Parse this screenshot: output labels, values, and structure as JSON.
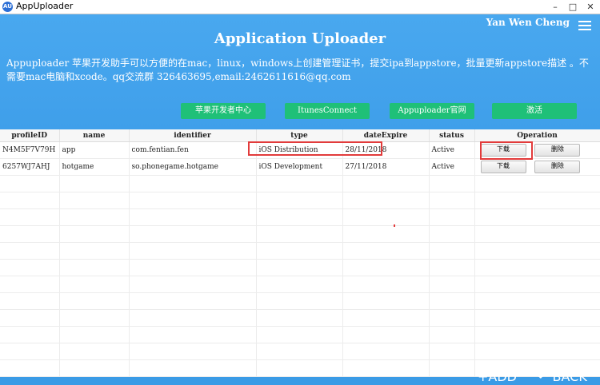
{
  "window": {
    "title": "AppUploader",
    "icon": "app-icon"
  },
  "header": {
    "user": "Yan Wen Cheng",
    "title": "Application Uploader",
    "description": "Appuploader 苹果开发助手可以方便的在mac，linux，windows上创建管理证书，提交ipa到appstore，批量更新appstore描述 。不需要mac电脑和xcode。qq交流群 326463695,email:2462611616@qq.com"
  },
  "nav": [
    {
      "label": "苹果开发者中心"
    },
    {
      "label": "ItunesConnect"
    },
    {
      "label": "Appuploader官网"
    },
    {
      "label": "激活"
    }
  ],
  "table": {
    "columns": [
      "profileID",
      "name",
      "identifier",
      "type",
      "dateExpire",
      "status",
      "Operation"
    ],
    "rows": [
      {
        "profileID": "N4M5F7V79H",
        "name": "app",
        "identifier": "com.fentian.fen",
        "type": "iOS Distribution",
        "dateExpire": "28/11/2018",
        "status": "Active",
        "download": "下载",
        "delete": "删除"
      },
      {
        "profileID": "6257WJ7AHJ",
        "name": "hotgame",
        "identifier": "so.phonegame.hotgame",
        "type": "iOS Development",
        "dateExpire": "27/11/2018",
        "status": "Active",
        "download": "下载",
        "delete": "删除"
      }
    ]
  },
  "footer": {
    "add": "+ADD",
    "back": "BACK"
  },
  "colors": {
    "header": "#3f9fea",
    "nav_button": "#1fc078",
    "highlight": "#e23b3b"
  }
}
